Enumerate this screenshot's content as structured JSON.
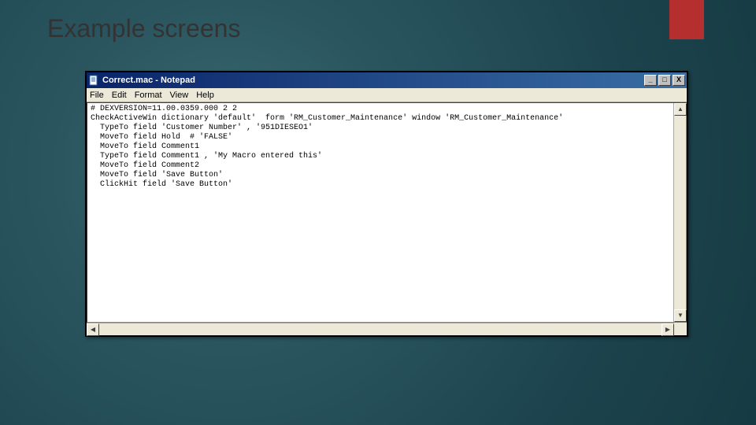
{
  "slide": {
    "title": "Example screens"
  },
  "notepad": {
    "title": "Correct.mac - Notepad",
    "menu": {
      "file": "File",
      "edit": "Edit",
      "format": "Format",
      "view": "View",
      "help": "Help"
    },
    "window_controls": {
      "min": "_",
      "max": "□",
      "close": "X"
    },
    "content": "# DEXVERSION=11.00.0359.000 2 2\nCheckActiveWin dictionary 'default'  form 'RM_Customer_Maintenance' window 'RM_Customer_Maintenance'\n  TypeTo field 'Customer Number' , '951DIESEO1'\n  MoveTo field Hold  # 'FALSE'\n  MoveTo field Comment1\n  TypeTo field Comment1 , 'My Macro entered this'\n  MoveTo field Comment2\n  MoveTo field 'Save Button'\n  ClickHit field 'Save Button'"
  }
}
